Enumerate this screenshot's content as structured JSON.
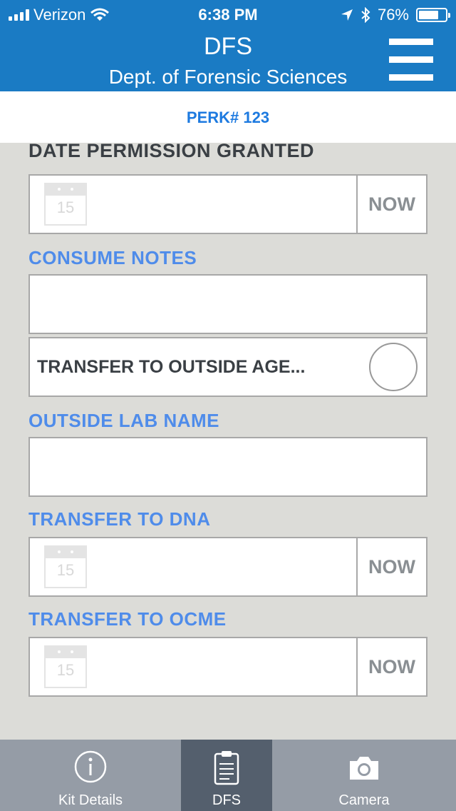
{
  "status_bar": {
    "carrier": "Verizon",
    "time": "6:38 PM",
    "battery": "76%",
    "battery_level": 0.76,
    "icons": [
      "signal-bars-icon",
      "wifi-icon",
      "location-arrow-icon",
      "bluetooth-icon",
      "battery-icon"
    ]
  },
  "header": {
    "title": "DFS",
    "subtitle": "Dept. of Forensic Sciences",
    "menu_icon": "hamburger-menu-icon"
  },
  "subheader": {
    "perk": "PERK# 123"
  },
  "form": {
    "date_permission": {
      "label": "DATE PERMISSION GRANTED",
      "calendar_day": "15",
      "now_label": "NOW"
    },
    "consume_notes": {
      "label": "CONSUME NOTES",
      "value": ""
    },
    "transfer_outside": {
      "label": "TRANSFER TO OUTSIDE AGE...",
      "checked": false
    },
    "outside_lab": {
      "label": "OUTSIDE LAB NAME",
      "value": ""
    },
    "transfer_dna": {
      "label": "TRANSFER TO DNA",
      "calendar_day": "15",
      "now_label": "NOW"
    },
    "transfer_ocme": {
      "label": "TRANSFER TO OCME",
      "calendar_day": "15",
      "now_label": "NOW"
    }
  },
  "tabs": [
    {
      "label": "Kit Details",
      "icon": "info-icon",
      "active": false
    },
    {
      "label": "DFS",
      "icon": "clipboard-icon",
      "active": true
    },
    {
      "label": "Camera",
      "icon": "camera-icon",
      "active": false
    }
  ],
  "colors": {
    "header_bg": "#1a7bc4",
    "accent_label": "#4f8cea",
    "perk_text": "#1d7ae0",
    "tab_bar_bg": "#959ca6",
    "tab_active_bg": "#545f6d"
  }
}
